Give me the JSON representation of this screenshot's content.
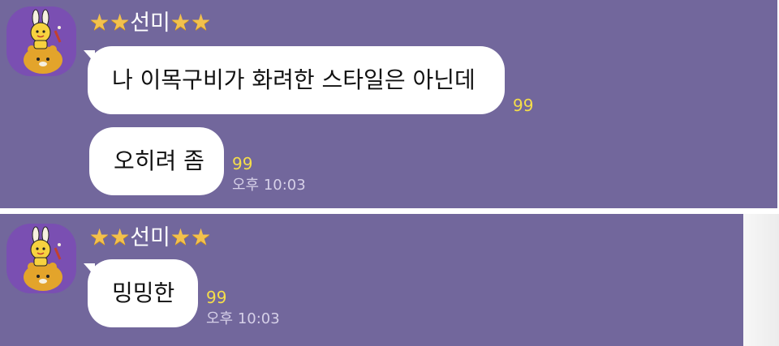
{
  "chat_1": {
    "sender": {
      "star_left": "★★",
      "name": "선미",
      "star_right": "★★"
    },
    "avatar_icon": "ryan-rabbit-character-avatar",
    "messages": [
      {
        "text": "나 이목구비가 화려한 스타일은 아닌데",
        "unread": "99"
      },
      {
        "text": "오히려 좀",
        "unread": "99",
        "time": "오후 10:03"
      }
    ]
  },
  "chat_2": {
    "sender": {
      "star_left": "★★",
      "name": "선미",
      "star_right": "★★"
    },
    "avatar_icon": "ryan-rabbit-character-avatar",
    "messages": [
      {
        "text": "밍밍한",
        "unread": "99",
        "time": "오후 10:03"
      }
    ]
  },
  "colors": {
    "background": "#72679c",
    "bubble": "#ffffff",
    "unread_count": "#f5de4a",
    "star": "#f3c14c"
  }
}
